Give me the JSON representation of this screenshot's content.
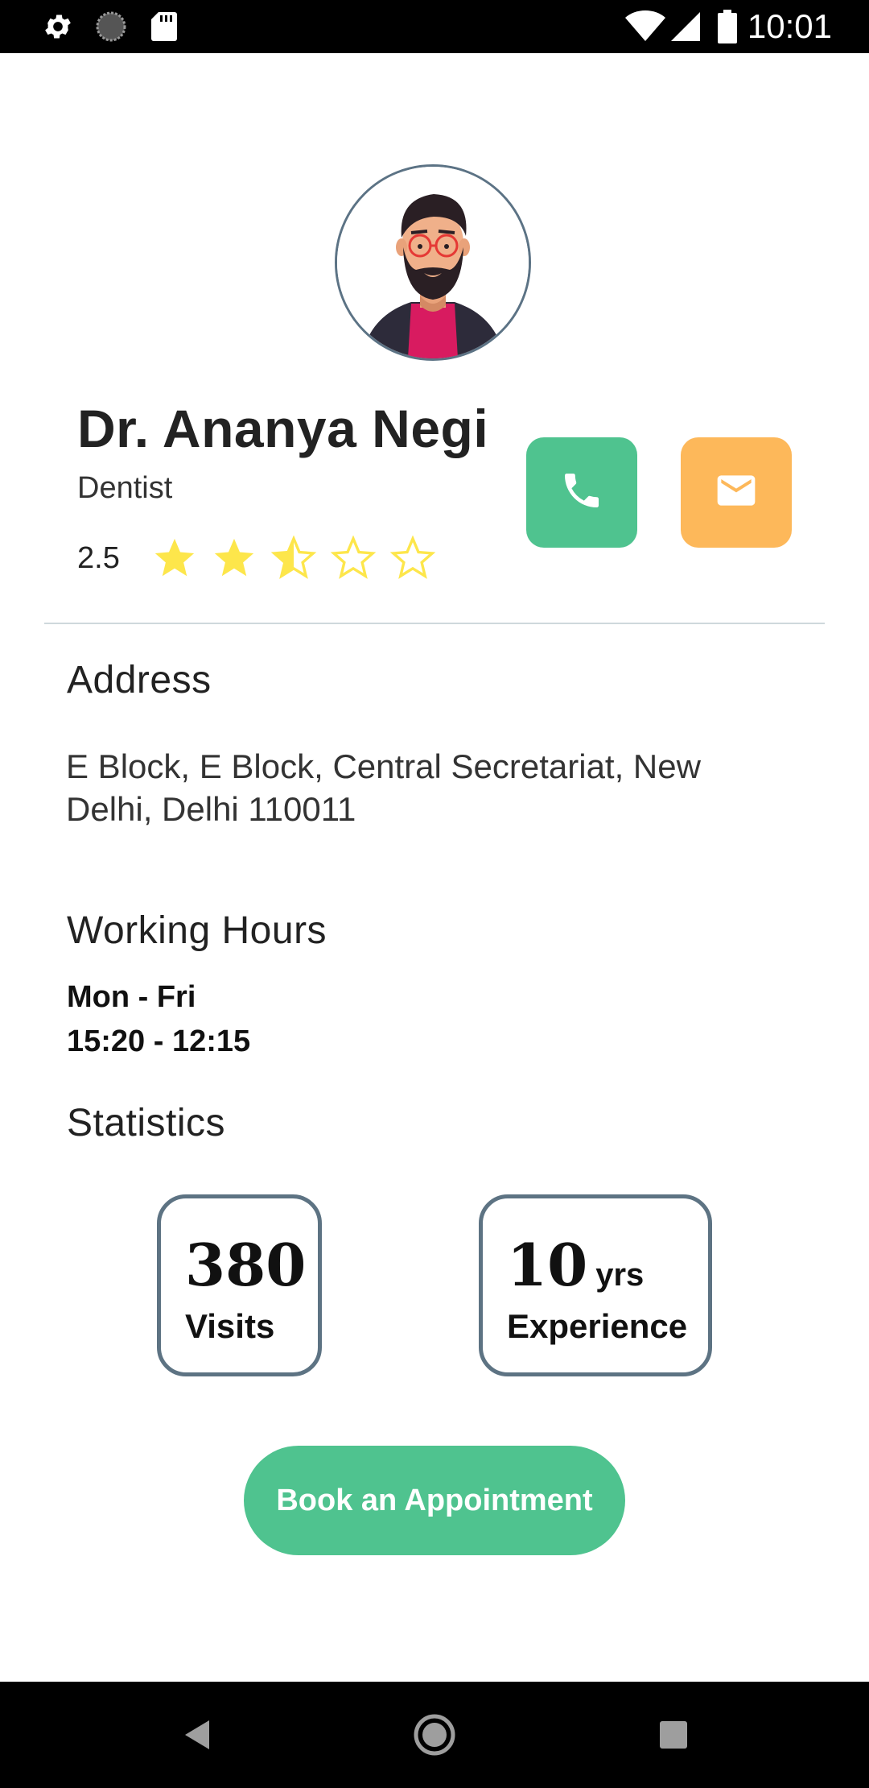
{
  "status_bar": {
    "time": "10:01",
    "left_icons": [
      "settings-icon",
      "loading-icon",
      "sd-card-icon"
    ],
    "right_icons": [
      "wifi-icon",
      "signal-icon",
      "battery-icon"
    ]
  },
  "profile": {
    "name": "Dr. Ananya Negi",
    "specialty": "Dentist",
    "rating_text": "2.5",
    "rating_value": 2.5,
    "rating_max": 5,
    "star_color": "#fde64b"
  },
  "actions": {
    "call_color": "#4fc38f",
    "email_color": "#fdb85a"
  },
  "address": {
    "title": "Address",
    "text": "E Block, E Block, Central Secretariat, New Delhi, Delhi 110011"
  },
  "working_hours": {
    "title": "Working Hours",
    "days": "Mon - Fri",
    "time": "15:20 - 12:15"
  },
  "statistics": {
    "title": "Statistics",
    "visits": {
      "value": "380",
      "label": "Visits"
    },
    "experience": {
      "value": "10",
      "unit": "yrs",
      "label": "Experience"
    }
  },
  "book_button": {
    "label": "Book an Appointment"
  },
  "nav_bar": {
    "buttons": [
      "back-icon",
      "home-icon",
      "recents-icon"
    ]
  }
}
